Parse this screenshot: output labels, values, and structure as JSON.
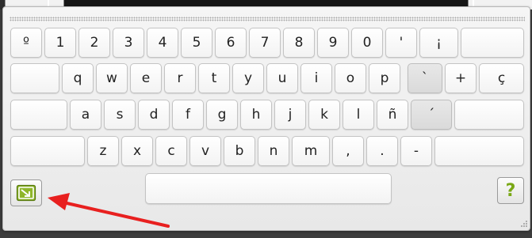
{
  "keyboard": {
    "rows": [
      [
        "º",
        "1",
        "2",
        "3",
        "4",
        "5",
        "6",
        "7",
        "8",
        "9",
        "0",
        "'",
        "¡"
      ],
      [
        "q",
        "w",
        "e",
        "r",
        "t",
        "y",
        "u",
        "i",
        "o",
        "p",
        "`",
        "+",
        "ç"
      ],
      [
        "a",
        "s",
        "d",
        "f",
        "g",
        "h",
        "j",
        "k",
        "l",
        "ñ",
        "´"
      ],
      [
        "z",
        "x",
        "c",
        "v",
        "b",
        "n",
        "m",
        ",",
        ".",
        "-"
      ]
    ],
    "help_label": "?"
  },
  "icons": {
    "minimize": "minimize-keyboard-icon",
    "help": "help-icon",
    "resize": "resize-grip-icon",
    "annotation": "red-arrow-annotation"
  },
  "colors": {
    "accent_green": "#7aa816",
    "annotation_red": "#e8201f"
  }
}
